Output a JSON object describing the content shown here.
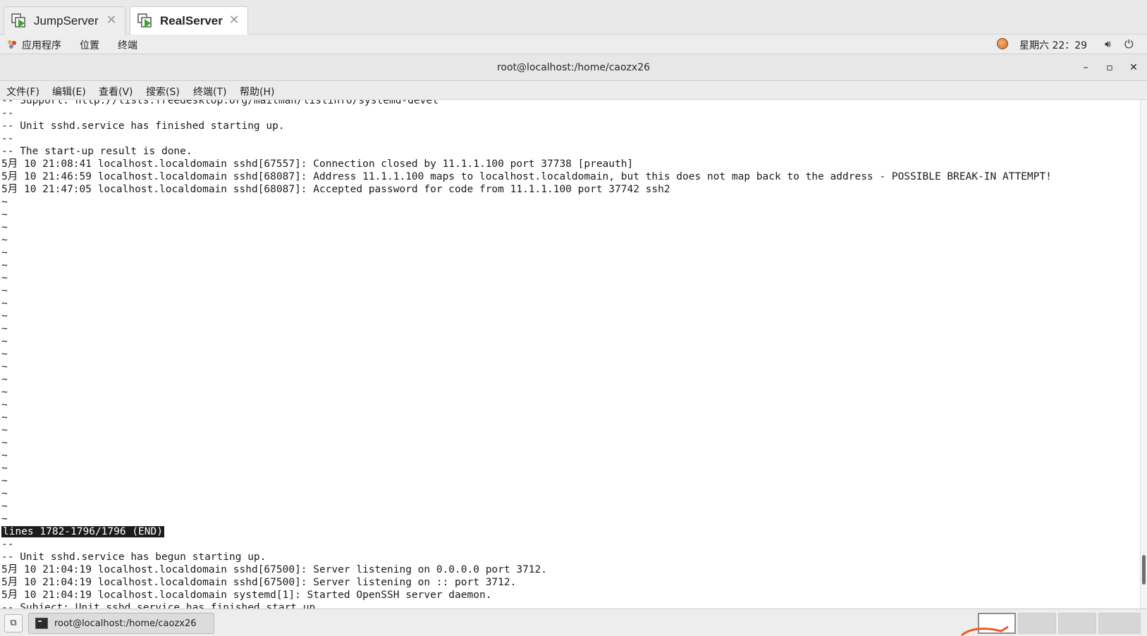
{
  "host_tabs": [
    {
      "label": "JumpServer",
      "active": false
    },
    {
      "label": "RealServer",
      "active": true
    }
  ],
  "panel": {
    "applications": "应用程序",
    "places": "位置",
    "terminal": "终端",
    "clock": "星期六 22：29"
  },
  "window": {
    "title": "root@localhost:/home/caozx26",
    "minimize": "–",
    "maximize": "▫",
    "close": "✕"
  },
  "menu": [
    "文件(F)",
    "编辑(E)",
    "查看(V)",
    "搜索(S)",
    "终端(T)",
    "帮助(H)"
  ],
  "terminal": {
    "top_lines": [
      "-- Support: http://lists.freedesktop.org/mailman/listinfo/systemd-devel",
      "--",
      "-- Unit sshd.service has finished starting up.",
      "--",
      "-- The start-up result is done.",
      "5月 10 21:08:41 localhost.localdomain sshd[67557]: Connection closed by 11.1.1.100 port 37738 [preauth]",
      "5月 10 21:46:59 localhost.localdomain sshd[68087]: Address 11.1.1.100 maps to localhost.localdomain, but this does not map back to the address - POSSIBLE BREAK-IN ATTEMPT!",
      "5月 10 21:47:05 localhost.localdomain sshd[68087]: Accepted password for code from 11.1.1.100 port 37742 ssh2"
    ],
    "tilde": "~",
    "tilde_count": 26,
    "status": "lines 1782-1796/1796 (END)",
    "bottom_lines": [
      "--",
      "-- Unit sshd.service has begun starting up.",
      "5月 10 21:04:19 localhost.localdomain sshd[67500]: Server listening on 0.0.0.0 port 3712.",
      "5月 10 21:04:19 localhost.localdomain sshd[67500]: Server listening on :: port 3712.",
      "5月 10 21:04:19 localhost.localdomain systemd[1]: Started OpenSSH server daemon.",
      "-- Subject: Unit sshd.service has finished start up"
    ]
  },
  "taskbar": {
    "task_label": "root@localhost:/home/caozx26"
  },
  "colors": {
    "tab_play": "#3aa62a",
    "status_bg": "#1c1c1c",
    "mascot": "#f05a28"
  }
}
